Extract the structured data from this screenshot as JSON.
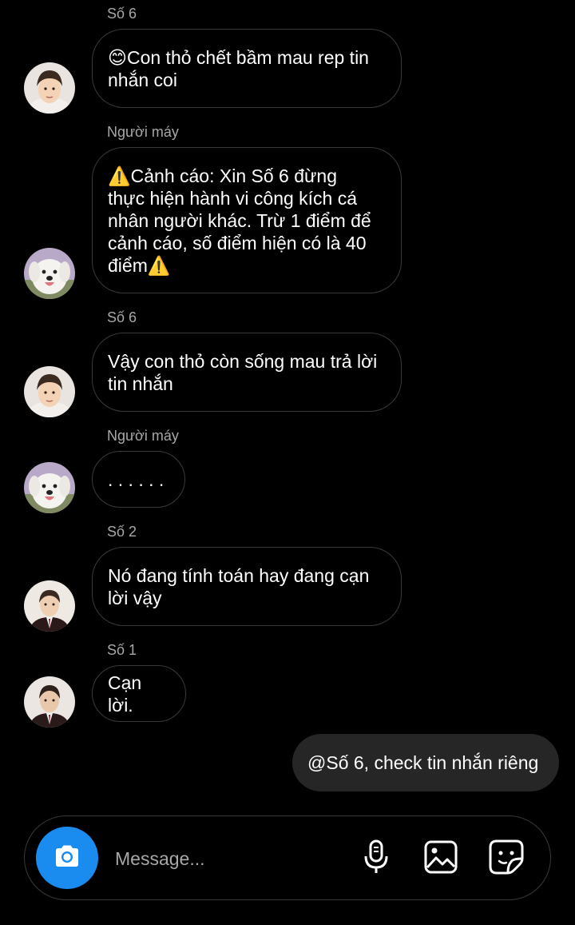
{
  "messages": [
    {
      "sender": "Số 6",
      "text": "😊Con thỏ chết bầm mau rep tin\nnhắn coi",
      "avatar": "boy-avatar"
    },
    {
      "sender": "Người máy",
      "text": "⚠️Cảnh cáo: Xin Số 6 đừng\nthực hiện hành vi công kích cá\nnhân người khác. Trừ 1 điểm để\ncảnh cáo, số điểm hiện có là 40\nđiểm⚠️",
      "avatar": "dog-avatar"
    },
    {
      "sender": "Số 6",
      "text": "Vậy con thỏ còn sống mau trả lời\ntin nhắn",
      "avatar": "boy-avatar"
    },
    {
      "sender": "Người máy",
      "text": ". . . . . .",
      "avatar": "dog-avatar"
    },
    {
      "sender": "Số 2",
      "text": "Nó đang tính toán hay đang cạn\nlời vậy",
      "avatar": "man-suit-avatar"
    },
    {
      "sender": "Số 1",
      "text": "Cạn lời.",
      "avatar": "man-suit-avatar"
    }
  ],
  "outgoing": {
    "text": "@Số 6, check tin nhắn riêng"
  },
  "composer": {
    "placeholder": "Message..."
  },
  "colors": {
    "background": "#000000",
    "bubble_border": "#3a3a3a",
    "outgoing_bubble": "#262626",
    "sender_label": "#a8a8a8",
    "camera_button": "#1a8cf0"
  },
  "icons": [
    "camera-icon",
    "microphone-icon",
    "gallery-icon",
    "sticker-icon"
  ]
}
